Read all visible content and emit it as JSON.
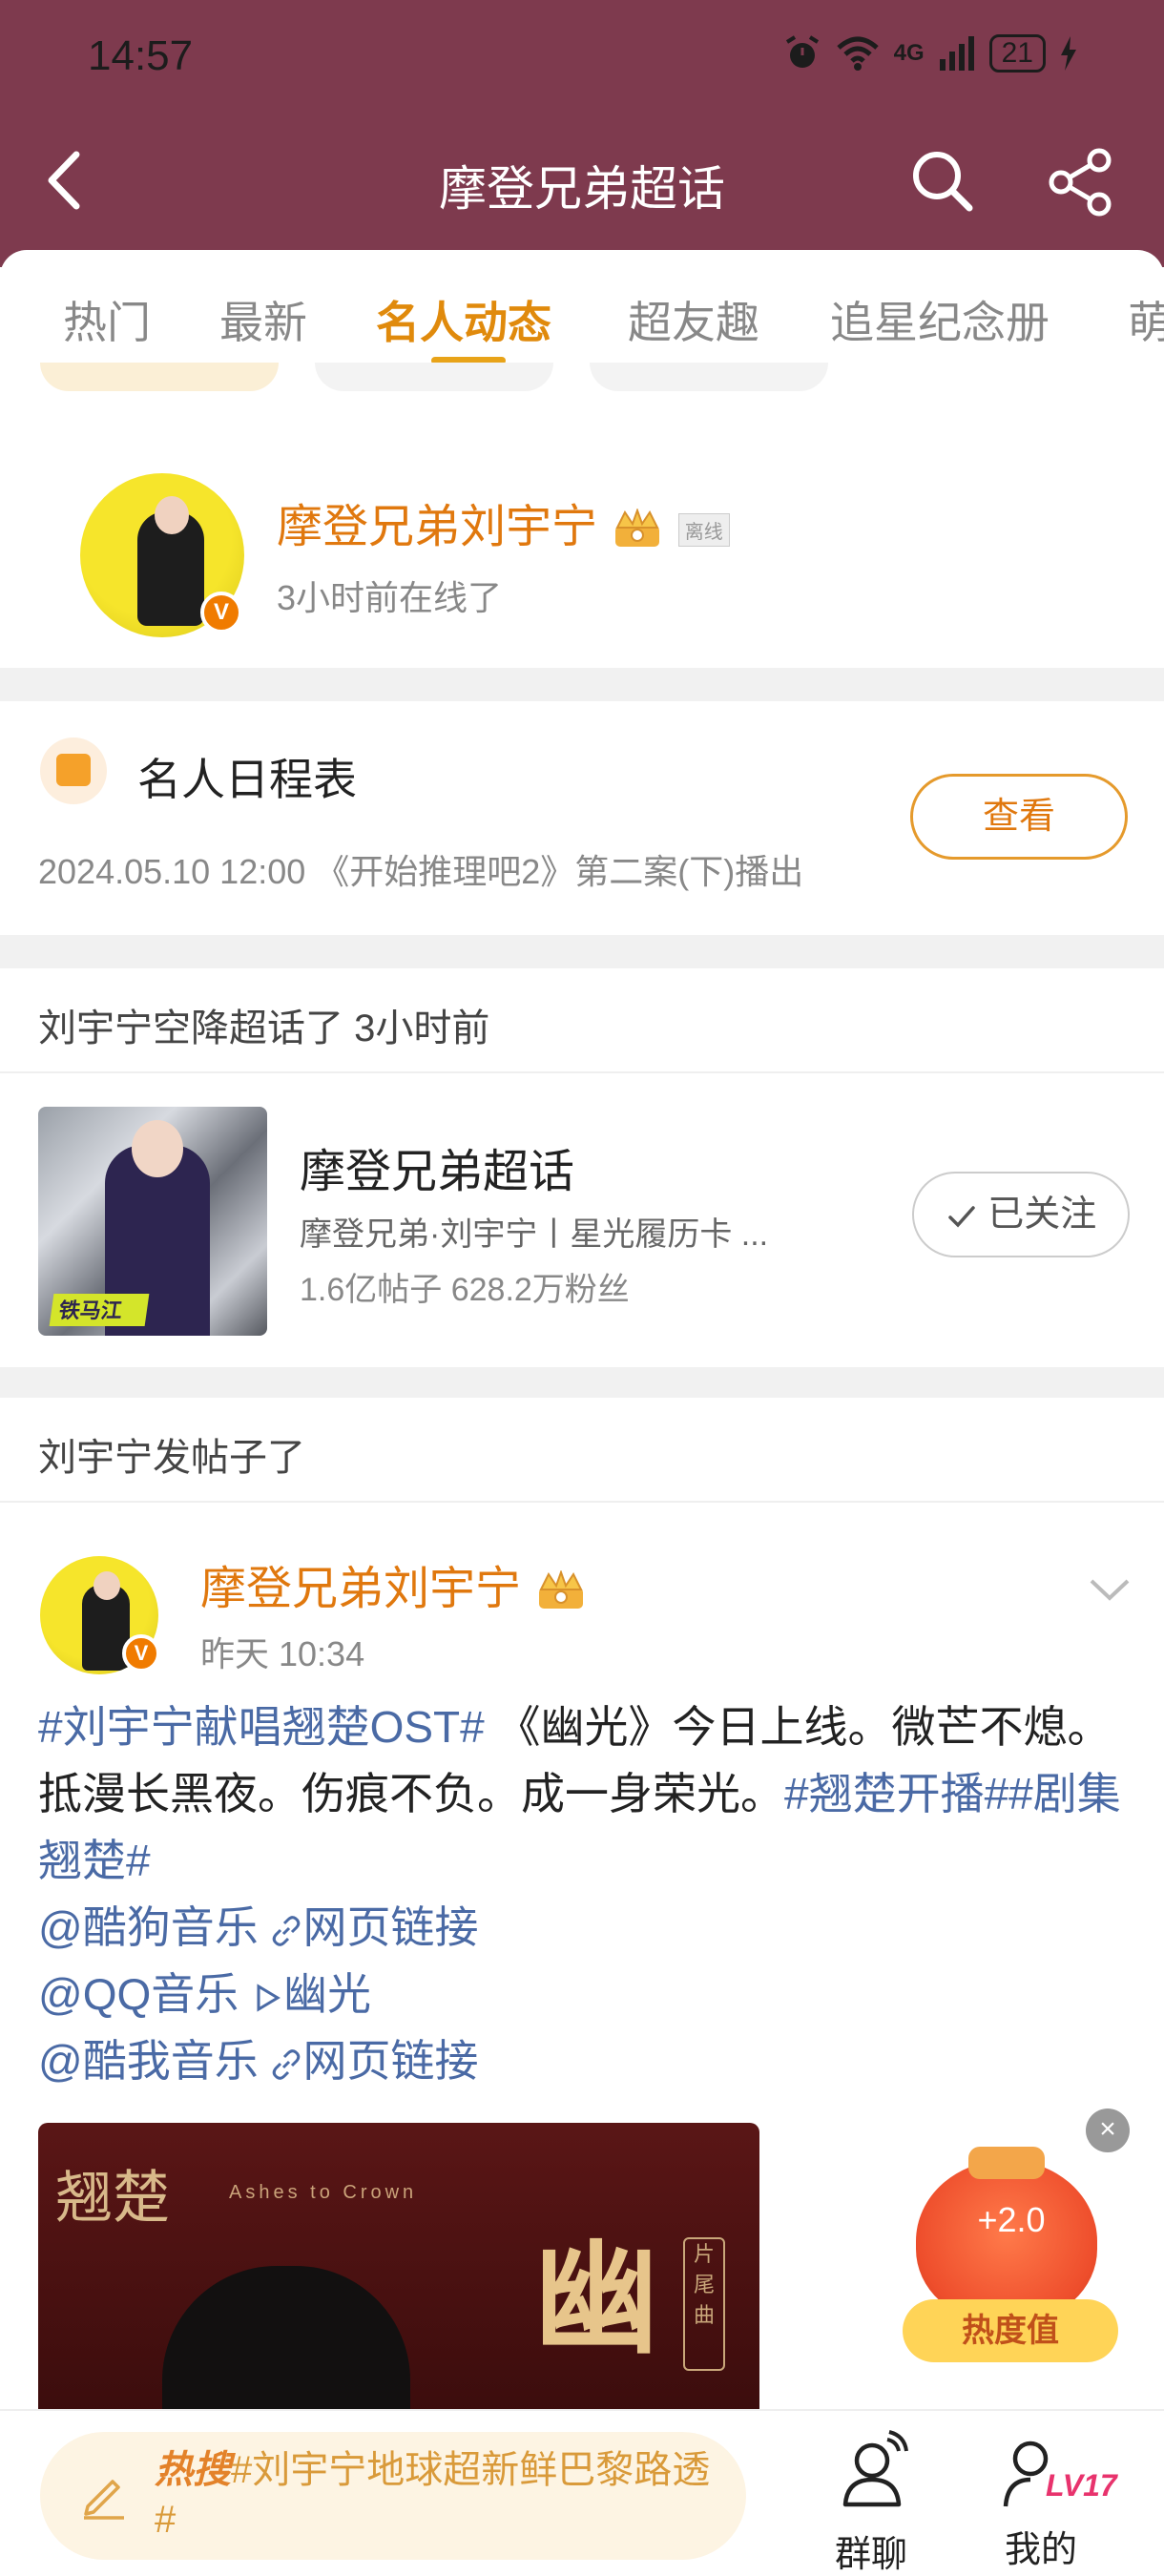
{
  "status_bar": {
    "time": "14:57",
    "network": "4G",
    "battery": "21"
  },
  "header": {
    "title": "摩登兄弟超话"
  },
  "tabs": [
    {
      "label": "热门"
    },
    {
      "label": "最新"
    },
    {
      "label": "名人动态"
    },
    {
      "label": "超友趣"
    },
    {
      "label": "追星纪念册"
    },
    {
      "label": "萌"
    }
  ],
  "active_tab": "名人动态",
  "profile": {
    "name": "摩登兄弟刘宇宁",
    "tag": "离线",
    "online_status": "3小时前在线了",
    "verified_mark": "V"
  },
  "schedule": {
    "title": "名人日程表",
    "item": "2024.05.10 12:00 《开始推理吧2》第二案(下)播出",
    "button": "查看"
  },
  "airdrop": {
    "heading": "刘宇宁空降超话了 3小时前",
    "topic": {
      "title": "摩登兄弟超话",
      "subtitle": "摩登兄弟·刘宇宁丨星光履历卡 ...",
      "stats": "1.6亿帖子 628.2万粉丝",
      "button": "已关注",
      "image_caption": "铁马江"
    }
  },
  "post_section": {
    "heading": "刘宇宁发帖子了",
    "author": "摩登兄弟刘宇宁",
    "time": "昨天 10:34",
    "body": {
      "tag1": "#刘宇宁献唱翘楚OST#",
      "text1": " 《幽光》今日上线。微芒不熄。抵漫长黑夜。伤痕不负。成一身荣光。",
      "tag2": "#翘楚开播#",
      "tag3": "#剧集翘楚#",
      "mention1": "@酷狗音乐",
      "link1": "网页链接",
      "mention2": "@QQ音乐",
      "link2": "幽光",
      "mention3": "@酷我音乐",
      "link3": "网页链接"
    },
    "image": {
      "title": "翘楚",
      "subtitle": "Ashes to Crown",
      "big_text": "幽光",
      "side_tag": "片尾曲"
    }
  },
  "heat_badge": {
    "value": "+2.0",
    "label": "热度值"
  },
  "bottom_bar": {
    "hot_label": "热搜",
    "hot_text": "#刘宇宁地球超新鲜巴黎路透#",
    "group_chat": "群聊",
    "mine": "我的",
    "level": "LV17"
  }
}
